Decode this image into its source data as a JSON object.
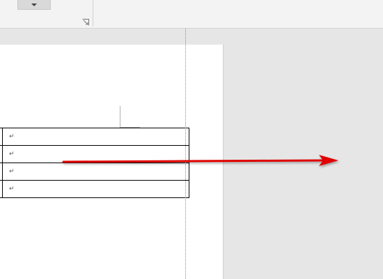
{
  "ribbon": {
    "dropdown_icon": "chevron-down-icon",
    "dialog_launcher_icon": "dialog-launcher-icon"
  },
  "table": {
    "rows": [
      {
        "mark": "↵"
      },
      {
        "mark": "↵"
      },
      {
        "mark": "↵"
      },
      {
        "mark": "↵"
      }
    ]
  },
  "annotation": {
    "arrow_color": "#e00000",
    "arrow_icon": "arrow-right-icon"
  }
}
